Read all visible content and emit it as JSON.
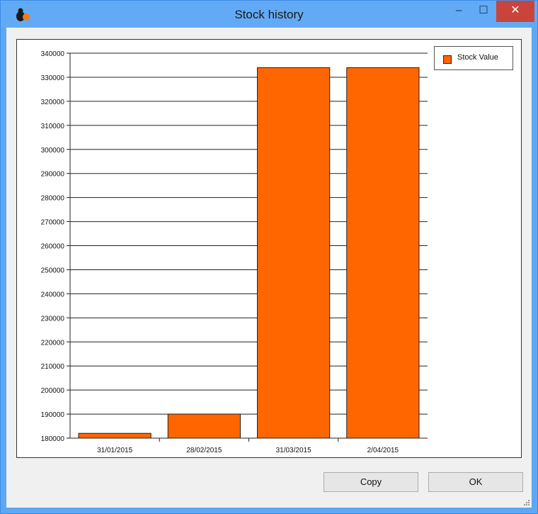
{
  "window": {
    "title": "Stock history",
    "controls": {
      "minimize_icon": "minimize-icon",
      "maximize_icon": "maximize-icon",
      "close_icon": "close-icon",
      "minimize_glyph": "–",
      "maximize_glyph": "☐",
      "close_glyph": "✕"
    }
  },
  "legend": {
    "label": "Stock Value"
  },
  "buttons": {
    "copy": "Copy",
    "ok": "OK"
  },
  "colors": {
    "bar": "#ff6600",
    "bar_border": "#222222",
    "titlebar": "#62aaf5",
    "close": "#c9443b"
  },
  "chart_data": {
    "type": "bar",
    "categories": [
      "31/01/2015",
      "28/02/2015",
      "31/03/2015",
      "2/04/2015"
    ],
    "series": [
      {
        "name": "Stock Value",
        "values": [
          182000,
          190000,
          334000,
          334000
        ]
      }
    ],
    "ylim": [
      180000,
      340000
    ],
    "yticks": [
      180000,
      190000,
      200000,
      210000,
      220000,
      230000,
      240000,
      250000,
      260000,
      270000,
      280000,
      290000,
      300000,
      310000,
      320000,
      330000,
      340000
    ],
    "grid": true,
    "legend_position": "top-right"
  }
}
